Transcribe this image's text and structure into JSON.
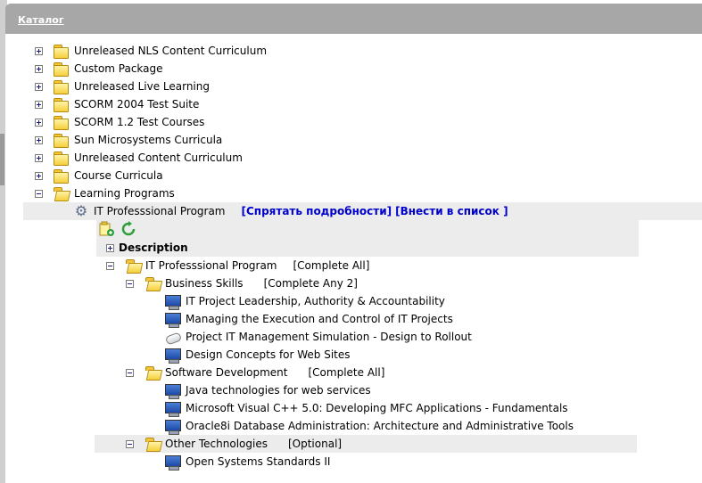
{
  "header": {
    "title": "Каталог"
  },
  "catalog": {
    "items": [
      {
        "label": "Unreleased NLS Content Curriculum"
      },
      {
        "label": "Custom Package"
      },
      {
        "label": "Unreleased Live Learning"
      },
      {
        "label": "SCORM 2004 Test Suite"
      },
      {
        "label": "SCORM 1.2 Test Courses"
      },
      {
        "label": "Sun Microsystems Curricula"
      },
      {
        "label": "Unreleased Content Curriculum"
      },
      {
        "label": "Course Curricula"
      },
      {
        "label": "Learning Programs"
      }
    ]
  },
  "program": {
    "title": "IT Professsional Program",
    "hide_details_link": "[Спрятать подробности]",
    "add_to_list_link": "[Внести в список ]",
    "description_label": "Description",
    "root": {
      "label": "IT Professsional Program",
      "status": "[Complete All]"
    },
    "groups": [
      {
        "label": "Business Skills",
        "status": "[Complete Any 2]",
        "items": [
          {
            "label": "IT Project Leadership, Authority & Accountability",
            "icon": "monitor-icon"
          },
          {
            "label": "Managing the Execution and Control of IT Projects",
            "icon": "monitor-icon"
          },
          {
            "label": "Project IT Management Simulation - Design to Rollout",
            "icon": "mouse-icon"
          },
          {
            "label": "Design Concepts for Web Sites",
            "icon": "monitor-icon"
          }
        ]
      },
      {
        "label": "Software Development",
        "status": "[Complete All]",
        "items": [
          {
            "label": "Java technologies for web services",
            "icon": "monitor-icon"
          },
          {
            "label": "Microsoft Visual C++ 5.0: Developing MFC Applications - Fundamentals",
            "icon": "monitor-icon"
          },
          {
            "label": "Oracle8i Database Administration: Architecture and Administrative Tools",
            "icon": "monitor-icon"
          }
        ]
      },
      {
        "label": "Other Technologies",
        "status": "[Optional]",
        "items": [
          {
            "label": "Open Systems Standards II",
            "icon": "monitor-icon"
          }
        ]
      }
    ]
  }
}
